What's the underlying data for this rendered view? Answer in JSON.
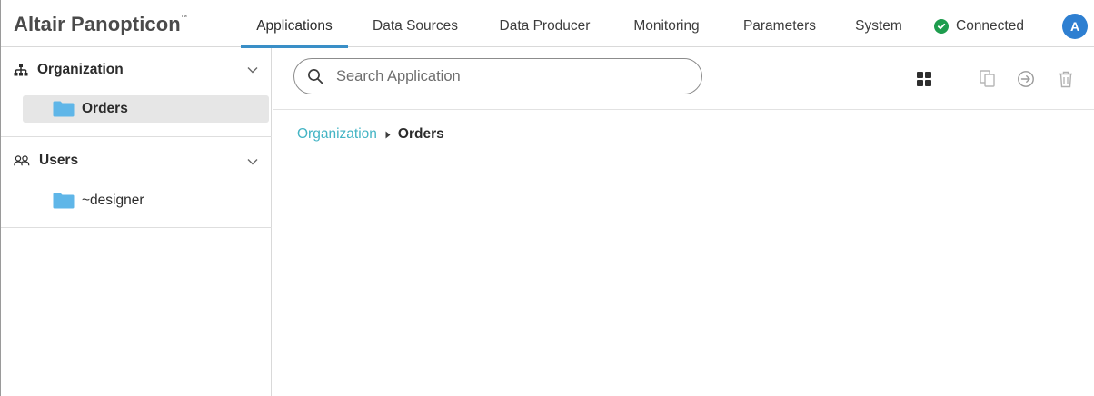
{
  "header": {
    "brand": "Altair Panopticon",
    "brand_tm": "™",
    "tabs": [
      {
        "label": "Applications"
      },
      {
        "label": "Data Sources"
      },
      {
        "label": "Data Producer"
      },
      {
        "label": "Monitoring"
      },
      {
        "label": "Parameters"
      },
      {
        "label": "System"
      }
    ],
    "active_tab": "Applications",
    "status_text": "Connected",
    "status_color": "#1e9d4e",
    "avatar_letter": "A",
    "accent": "#3a8fc7"
  },
  "sidebar": {
    "sections": [
      {
        "title": "Organization",
        "icon": "org-hierarchy-icon",
        "items": [
          {
            "label": "Orders",
            "selected": true
          }
        ]
      },
      {
        "title": "Users",
        "icon": "users-icon",
        "items": [
          {
            "label": "~designer",
            "selected": false
          }
        ]
      }
    ]
  },
  "main": {
    "search_placeholder": "Search Application",
    "toolbar_icons": [
      "grid-view-icon",
      "copy-icon",
      "move-icon",
      "delete-icon"
    ],
    "breadcrumb": {
      "parent": "Organization",
      "current": "Orders"
    },
    "link_color": "#43b4c4"
  }
}
